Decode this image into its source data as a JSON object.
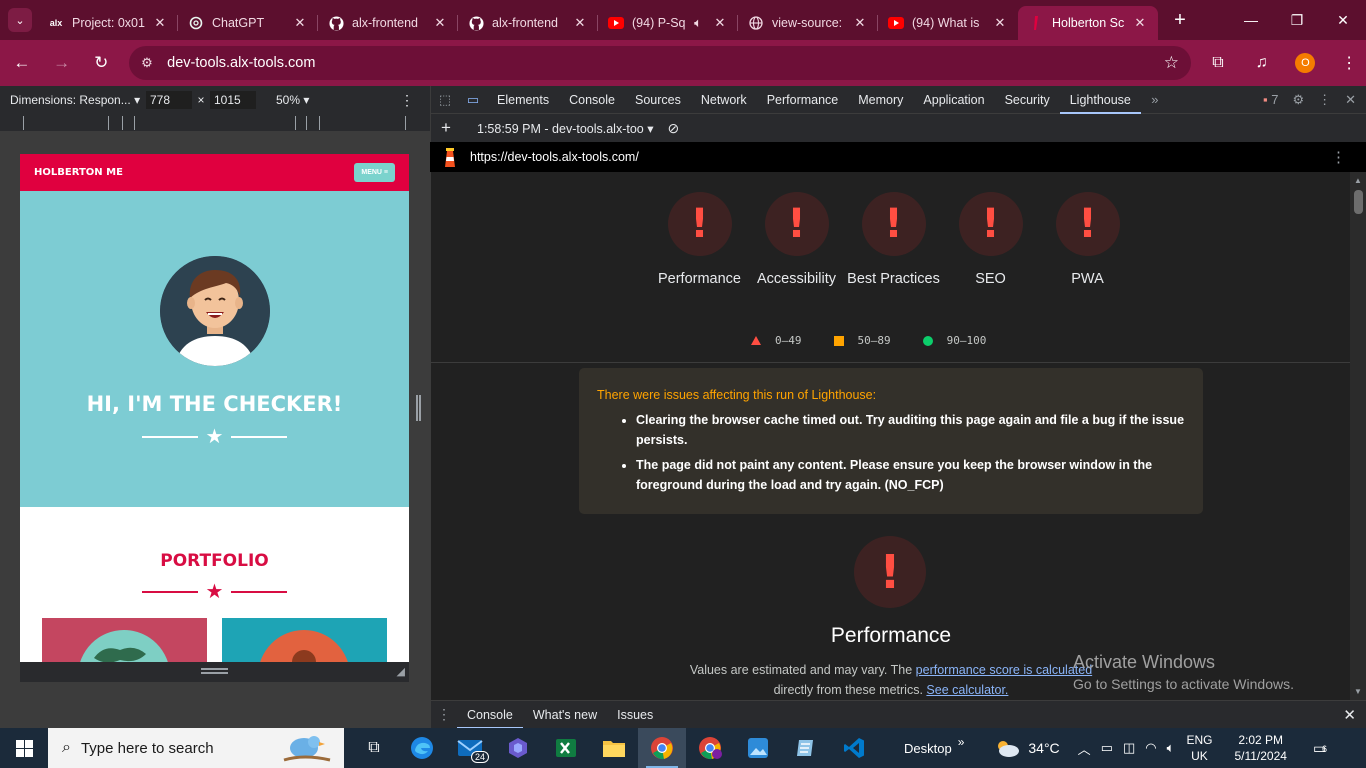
{
  "browser": {
    "tabs": [
      {
        "title": "Project: 0x01",
        "icon": "alx-icon"
      },
      {
        "title": "ChatGPT",
        "icon": "openai-icon"
      },
      {
        "title": "alx-frontend",
        "icon": "github-icon"
      },
      {
        "title": "alx-frontend",
        "icon": "github-icon"
      },
      {
        "title": "(94) P-Sq",
        "icon": "youtube-icon"
      },
      {
        "title": "view-source:",
        "icon": "globe-icon"
      },
      {
        "title": "(94) What is",
        "icon": "youtube-icon"
      },
      {
        "title": "Holberton Sc",
        "icon": "holberton-icon",
        "active": true
      }
    ],
    "url": "dev-tools.alx-tools.com",
    "profile_initial": "O",
    "accent": "#8c1747"
  },
  "device": {
    "dimensions_label": "Dimensions: Respon...",
    "width": "778",
    "height": "1015",
    "zoom": "50%",
    "times": "×"
  },
  "site": {
    "brand": "HOLBERTON ME",
    "menu": "MENU ≡",
    "hero_title": "HI, I'M THE CHECKER!",
    "portfolio_title": "PORTFOLIO",
    "brand_color": "#e0003f",
    "hero_color": "#7dccd3"
  },
  "devtools": {
    "tabs": [
      "Elements",
      "Console",
      "Sources",
      "Network",
      "Performance",
      "Memory",
      "Application",
      "Security",
      "Lighthouse"
    ],
    "active_tab": "Lighthouse",
    "issues_count": "7",
    "run_label": "1:58:59 PM - dev-tools.alx-too",
    "report_url": "https://dev-tools.alx-tools.com/"
  },
  "lighthouse": {
    "gauges": [
      {
        "label": "Performance",
        "symbol": "!"
      },
      {
        "label": "Accessibility",
        "symbol": "!"
      },
      {
        "label": "Best Practices",
        "symbol": "!"
      },
      {
        "label": "SEO",
        "symbol": "!"
      },
      {
        "label": "PWA",
        "symbol": "!"
      }
    ],
    "legend": [
      "0–49",
      "50–89",
      "90–100"
    ],
    "warning_head": "There were issues affecting this run of Lighthouse:",
    "warnings": [
      "Clearing the browser cache timed out. Try auditing this page again and file a bug if the issue persists.",
      "The page did not paint any content. Please ensure you keep the browser window in the foreground during the load and try again. (NO_FCP)"
    ],
    "perf_symbol": "!",
    "perf_title": "Performance",
    "perf_note_1": "Values are estimated and may vary. The",
    "perf_link_1": "performance score is calculated",
    "perf_note_2": "directly from these metrics.",
    "perf_link_2": "See calculator."
  },
  "drawer": {
    "tabs": [
      "Console",
      "What's new",
      "Issues"
    ],
    "active": "Console"
  },
  "watermark": {
    "line1": "Activate Windows",
    "line2": "Go to Settings to activate Windows."
  },
  "taskbar": {
    "search_placeholder": "Type here to search",
    "mail_badge": "24",
    "desktop_label": "Desktop",
    "temperature": "34°C",
    "lang_1": "ENG",
    "lang_2": "UK",
    "time": "2:02 PM",
    "date": "5/11/2024",
    "notif_count": "6"
  }
}
